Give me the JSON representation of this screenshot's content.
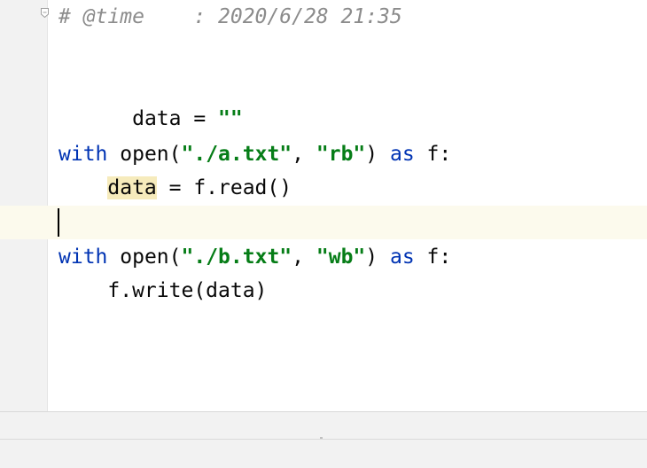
{
  "editor": {
    "lines": [
      {
        "text": "# @time    : 2020/6/28 21:35"
      },
      {
        "text": ""
      },
      {
        "text": "data = \"\""
      },
      {
        "text": ""
      },
      {
        "kw1": "with",
        "fn": "open(",
        "s1": "\"./a.txt\"",
        "comma": ", ",
        "s2": "\"rb\"",
        "close": ")",
        "kw2": "as",
        "tail": " f:"
      },
      {
        "indent": "    ",
        "var": "data",
        "rest": " = f.read()"
      },
      {
        "text": ""
      },
      {
        "kw1": "with",
        "fn": "open(",
        "s1": "\"./b.txt\"",
        "comma": ", ",
        "s2": "\"wb\"",
        "close": ")",
        "kw2": "as",
        "tail": " f:"
      },
      {
        "indent": "    ",
        "rest": "f.write(data)"
      }
    ]
  },
  "colors": {
    "keyword": "#0033b3",
    "string": "#067d17",
    "comment": "#8c8c8c",
    "current_line": "#fcfaed",
    "usage_highlight": "#f6ebbc"
  }
}
